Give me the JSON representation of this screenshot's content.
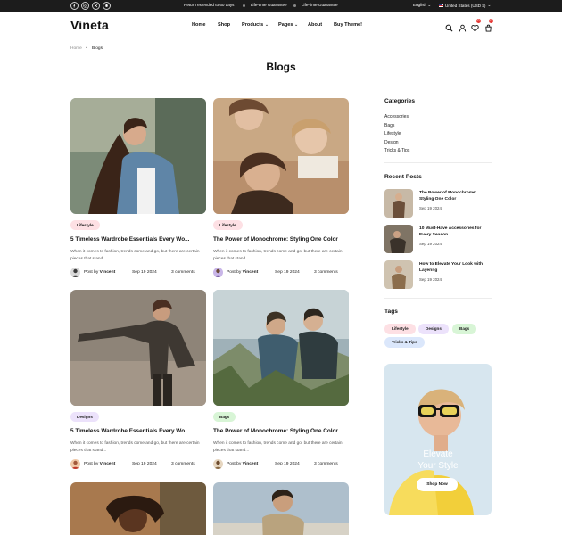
{
  "topbar": {
    "social_icons": [
      "facebook-icon",
      "instagram-icon",
      "x-icon",
      "snapchat-icon"
    ],
    "announcements": [
      "Return extended to 60 days",
      "Life-time Guarantee",
      "Life-time Guarantee"
    ],
    "language": "English",
    "currency": "United States (USD $)"
  },
  "header": {
    "logo": "Vineta",
    "nav": [
      {
        "label": "Home",
        "dropdown": false
      },
      {
        "label": "Shop",
        "dropdown": false
      },
      {
        "label": "Products",
        "dropdown": true
      },
      {
        "label": "Pages",
        "dropdown": true
      },
      {
        "label": "About",
        "dropdown": false
      },
      {
        "label": "Buy Theme!",
        "dropdown": false
      }
    ],
    "icons": [
      "search-icon",
      "user-icon",
      "heart-icon",
      "cart-icon"
    ],
    "wishlist_count": "0",
    "cart_count": "0"
  },
  "breadcrumb": {
    "home": "Home",
    "current": "Blogs"
  },
  "page_title": "Blogs",
  "posts": [
    {
      "tag": "Lifestyle",
      "tag_color": "#fde0e4",
      "title": "5 Timeless Wardrobe Essentials Every Wo...",
      "excerpt": "When it comes to fashion, trends come and go, but there are certain pieces that stand...",
      "author_prefix": "Post by",
      "author": "Vincent",
      "date": "Sep 19 2024",
      "comments": "3 comments"
    },
    {
      "tag": "Lifestyle",
      "tag_color": "#fde0e4",
      "title": "The Power of Monochrome: Styling One Color",
      "excerpt": "When it comes to fashion, trends come and go, but there are certain pieces that stand...",
      "author_prefix": "Post by",
      "author": "Vincent",
      "date": "Sep 19 2024",
      "comments": "3 comments"
    },
    {
      "tag": "Designs",
      "tag_color": "#ece2fb",
      "title": "5 Timeless Wardrobe Essentials Every Wo...",
      "excerpt": "When it comes to fashion, trends come and go, but there are certain pieces that stand...",
      "author_prefix": "Post by",
      "author": "Vincent",
      "date": "Sep 19 2024",
      "comments": "3 comments"
    },
    {
      "tag": "Bags",
      "tag_color": "#d8f5d6",
      "title": "The Power of Monochrome: Styling One Color",
      "excerpt": "When it comes to fashion, trends come and go, but there are certain pieces that stand...",
      "author_prefix": "Post by",
      "author": "Vincent",
      "date": "Sep 19 2024",
      "comments": "3 comments"
    }
  ],
  "sidebar": {
    "categories_title": "Categories",
    "categories": [
      "Accessories",
      "Bags",
      "Lifestyle",
      "Design",
      "Tricks & Tips"
    ],
    "recent_title": "Recent Posts",
    "recent_posts": [
      {
        "title": "The Power of Monochrome: Styling One Color",
        "date": "Sep 19 2024"
      },
      {
        "title": "10 Must-Have Accessories for Every Season",
        "date": "Sep 19 2024"
      },
      {
        "title": "How to Elevate Your Look with Layering",
        "date": "Sep 19 2024"
      }
    ],
    "tags_title": "Tags",
    "tags": [
      {
        "label": "Lifestyle",
        "color": "#fde0e4"
      },
      {
        "label": "Designs",
        "color": "#ece2fb"
      },
      {
        "label": "Bags",
        "color": "#d8f5d6"
      },
      {
        "label": "Tricks & Tips",
        "color": "#dbe7fb"
      }
    ],
    "banner": {
      "line1": "Elevate",
      "line2": "Your Style",
      "button": "Shop Now"
    }
  }
}
